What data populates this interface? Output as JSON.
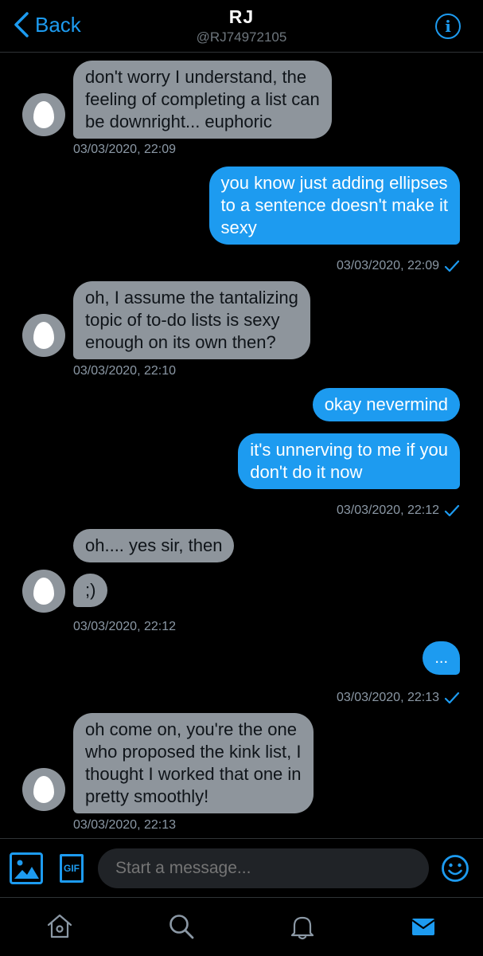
{
  "header": {
    "back_label": "Back",
    "title": "RJ",
    "handle": "@RJ74972105"
  },
  "messages": [
    {
      "side": "in",
      "text": "don't worry I understand, the\nfeeling of completing a list can\nbe downright... euphoric"
    },
    {
      "side": "in",
      "timestamp": "03/03/2020, 22:09"
    },
    {
      "side": "out",
      "text": "you know just adding ellipses\nto a sentence doesn't make it\nsexy"
    },
    {
      "side": "out",
      "timestamp": "03/03/2020, 22:09"
    },
    {
      "side": "in",
      "text": "oh, I assume the tantalizing\ntopic of to-do lists is sexy\nenough on its own then?"
    },
    {
      "side": "in",
      "timestamp": "03/03/2020, 22:10"
    },
    {
      "side": "out",
      "text": "okay nevermind"
    },
    {
      "side": "out",
      "text": "it's unnerving to me if you\ndon't do it now"
    },
    {
      "side": "out",
      "timestamp": "03/03/2020, 22:12"
    },
    {
      "side": "in",
      "text": "oh.... yes sir, then"
    },
    {
      "side": "in",
      "text": ";)"
    },
    {
      "side": "in",
      "timestamp": "03/03/2020, 22:12"
    },
    {
      "side": "out",
      "text": "..."
    },
    {
      "side": "out",
      "timestamp": "03/03/2020, 22:13"
    },
    {
      "side": "in",
      "text": "oh come on, you're the one\nwho proposed the kink list, I\nthought I worked that one in\npretty smoothly!"
    },
    {
      "side": "in",
      "timestamp": "03/03/2020, 22:13"
    }
  ],
  "composer": {
    "placeholder": "Start a message...",
    "gif_label": "GIF"
  },
  "tabbar": {
    "icons": [
      "home-icon",
      "search-icon",
      "notifications-icon",
      "messages-icon"
    ],
    "active": "messages-icon"
  },
  "colors": {
    "accent": "#1d9bf0",
    "incoming_bubble": "#8e959c",
    "background": "#000000"
  }
}
